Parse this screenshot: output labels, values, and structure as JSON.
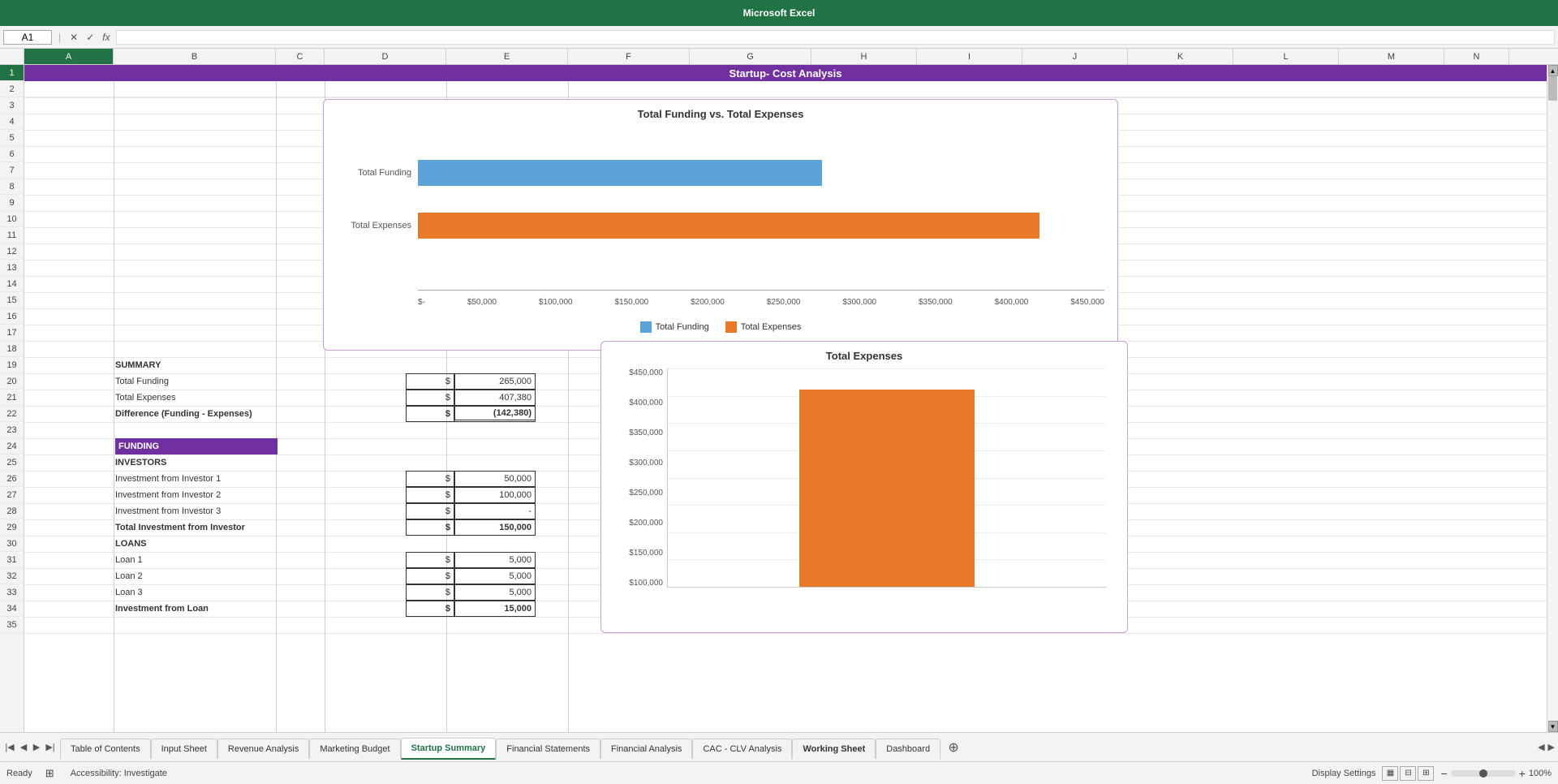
{
  "app": {
    "title": "Microsoft Excel"
  },
  "formulaBar": {
    "cellRef": "A1",
    "icons": [
      "✕",
      "✓",
      "fx"
    ],
    "value": ""
  },
  "columns": [
    "A",
    "B",
    "C",
    "D",
    "E",
    "F",
    "G",
    "H",
    "I",
    "J",
    "K",
    "L",
    "M",
    "N"
  ],
  "rows": [
    "1",
    "2",
    "3",
    "4",
    "5",
    "6",
    "7",
    "8",
    "9",
    "10",
    "11",
    "12",
    "13",
    "14",
    "15",
    "16",
    "17",
    "18",
    "19",
    "20",
    "21",
    "22",
    "23",
    "24",
    "25",
    "26",
    "27",
    "28",
    "29",
    "30",
    "31",
    "32",
    "33",
    "34",
    "35"
  ],
  "titleRow": {
    "text": "Startup- Cost Analysis",
    "bgColor": "#7030A0"
  },
  "chart1": {
    "title": "Total Funding vs. Total Expenses",
    "bars": [
      {
        "label": "Total Funding",
        "value": 265000,
        "maxValue": 450000,
        "color": "#5ba3d9"
      },
      {
        "label": "Total Expenses",
        "value": 407380,
        "maxValue": 450000,
        "color": "#e8782a"
      }
    ],
    "xLabels": [
      "$-",
      "$50,000",
      "$100,000",
      "$150,000",
      "$200,000",
      "$250,000",
      "$300,000",
      "$350,000",
      "$400,000",
      "$450,000"
    ],
    "legend": [
      {
        "label": "Total Funding",
        "color": "#5ba3d9"
      },
      {
        "label": "Total Expenses",
        "color": "#e8782a"
      }
    ]
  },
  "summary": {
    "header": "SUMMARY",
    "rows": [
      {
        "label": "Total Funding",
        "value": "$ 265,000",
        "bold": false
      },
      {
        "label": "Total Expenses",
        "value": "$ 407,380",
        "bold": false
      },
      {
        "label": "Difference (Funding - Expenses)",
        "value": "$ (142,380)",
        "bold": true
      }
    ],
    "fundingHeader": "FUNDING",
    "investors": {
      "header": "INVESTORS",
      "rows": [
        {
          "label": "Investment from Investor 1",
          "value": "$ 50,000"
        },
        {
          "label": "Investment from Investor 2",
          "value": "$ 100,000"
        },
        {
          "label": "Investment from Investor 3",
          "value": "$ -"
        },
        {
          "label": "Total Investment from Investor",
          "value": "$ 150,000",
          "bold": true
        }
      ]
    },
    "loans": {
      "header": "LOANS",
      "rows": [
        {
          "label": "Loan 1",
          "value": "$ 5,000"
        },
        {
          "label": "Loan 2",
          "value": "$ 5,000"
        },
        {
          "label": "Loan 3",
          "value": "$ 5,000"
        },
        {
          "label": "Investment from Loan",
          "value": "$ 15,000",
          "bold": true
        }
      ]
    }
  },
  "chart2": {
    "title": "Total Expenses",
    "yLabels": [
      "$450,000",
      "$400,000",
      "$350,000",
      "$300,000",
      "$250,000",
      "$200,000",
      "$150,000",
      "$100,000"
    ],
    "bar": {
      "value": 407380,
      "maxValue": 450000,
      "color": "#e8782a"
    }
  },
  "tabs": [
    {
      "label": "Table of Contents",
      "active": false
    },
    {
      "label": "Input Sheet",
      "active": false
    },
    {
      "label": "Revenue Analysis",
      "active": false
    },
    {
      "label": "Marketing Budget",
      "active": false
    },
    {
      "label": "Startup Summary",
      "active": true
    },
    {
      "label": "Financial Statements",
      "active": false
    },
    {
      "label": "Financial Analysis",
      "active": false
    },
    {
      "label": "CAC - CLV Analysis",
      "active": false
    },
    {
      "label": "Working Sheet",
      "active": false
    },
    {
      "label": "Dashboard",
      "active": false
    }
  ],
  "statusBar": {
    "ready": "Ready",
    "accessibility": "Accessibility: Investigate",
    "displaySettings": "Display Settings",
    "viewIcons": [
      "grid",
      "normal",
      "layout",
      "plus",
      "minus"
    ],
    "zoom": "100%"
  }
}
